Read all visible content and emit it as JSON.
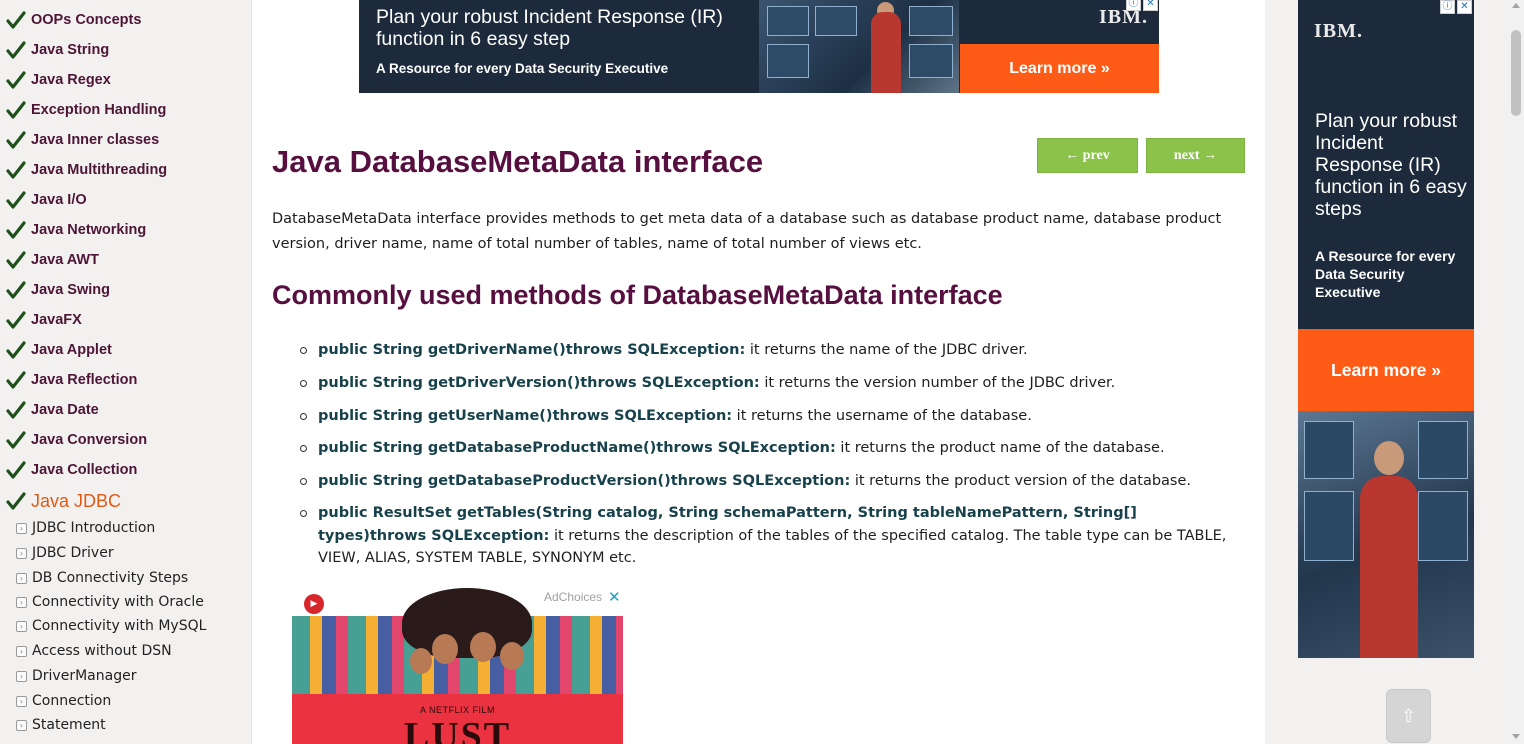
{
  "sidebar": {
    "categories": [
      {
        "label": "OOPs Concepts"
      },
      {
        "label": "Java String"
      },
      {
        "label": "Java Regex"
      },
      {
        "label": "Exception Handling"
      },
      {
        "label": "Java Inner classes"
      },
      {
        "label": "Java Multithreading"
      },
      {
        "label": "Java I/O"
      },
      {
        "label": "Java Networking"
      },
      {
        "label": "Java AWT"
      },
      {
        "label": "Java Swing"
      },
      {
        "label": "JavaFX"
      },
      {
        "label": "Java Applet"
      },
      {
        "label": "Java Reflection"
      },
      {
        "label": "Java Date"
      },
      {
        "label": "Java Conversion"
      },
      {
        "label": "Java Collection"
      },
      {
        "label": "Java JDBC",
        "active": true
      }
    ],
    "subitems": [
      {
        "label": "JDBC Introduction"
      },
      {
        "label": "JDBC Driver"
      },
      {
        "label": "DB Connectivity Steps"
      },
      {
        "label": "Connectivity with Oracle"
      },
      {
        "label": "Connectivity with MySQL"
      },
      {
        "label": "Access without DSN"
      },
      {
        "label": "DriverManager"
      },
      {
        "label": "Connection"
      },
      {
        "label": "Statement"
      }
    ],
    "icon_category": "checkmark-icon",
    "icon_subitem": "expand-bullet-icon",
    "colors": {
      "category_text": "#4d1536",
      "active_text": "#e05a16",
      "check": "#1f4f1a"
    }
  },
  "top_ad": {
    "headline": "Plan your robust Incident Response (IR) function in 6 easy step",
    "subline": "A Resource for every Data Security Executive",
    "brand": "IBM.",
    "cta": "Learn more »",
    "info_icon": "ⓘ",
    "close_icon": "✕"
  },
  "article": {
    "title": "Java DatabaseMetaData interface",
    "prev_label": "← prev",
    "next_label": "next →",
    "intro": "DatabaseMetaData interface provides methods to get meta data of a database such as database product name, database product version, driver name, name of total number of tables, name of total number of views etc.",
    "section_title": "Commonly used methods of DatabaseMetaData interface",
    "methods": [
      {
        "signature": "public String getDriverName()throws SQLException:",
        "desc": " it returns the name of the JDBC driver."
      },
      {
        "signature": "public String getDriverVersion()throws SQLException:",
        "desc": " it returns the version number of the JDBC driver."
      },
      {
        "signature": "public String getUserName()throws SQLException:",
        "desc": " it returns the username of the database."
      },
      {
        "signature": "public String getDatabaseProductName()throws SQLException:",
        "desc": " it returns the product name of the database."
      },
      {
        "signature": "public String getDatabaseProductVersion()throws SQLException:",
        "desc": " it returns the product version of the database."
      },
      {
        "signature": "public ResultSet getTables(String catalog, String schemaPattern, String tableNamePattern, String[] types)throws SQLException:",
        "desc": " it returns the description of the tables of the specified catalog. The table type can be TABLE, VIEW, ALIAS, SYSTEM TABLE, SYNONYM etc."
      }
    ],
    "colors": {
      "heading": "#560f3f",
      "method_sig": "#17424c",
      "nav_button": "#8bc34a"
    }
  },
  "video_ad": {
    "adchoices": "AdChoices",
    "close_icon": "✕",
    "play_icon": "▶",
    "tagline": "A NETFLIX FILM",
    "title": "LUST"
  },
  "side_ad": {
    "brand": "IBM.",
    "headline": "Plan your robust Incident Response (IR) function in 6 easy steps",
    "subline": "A Resource for every Data Security Executive",
    "cta": "Learn more »",
    "info_icon": "ⓘ",
    "close_icon": "✕"
  },
  "back_to_top": {
    "icon": "⇧"
  }
}
